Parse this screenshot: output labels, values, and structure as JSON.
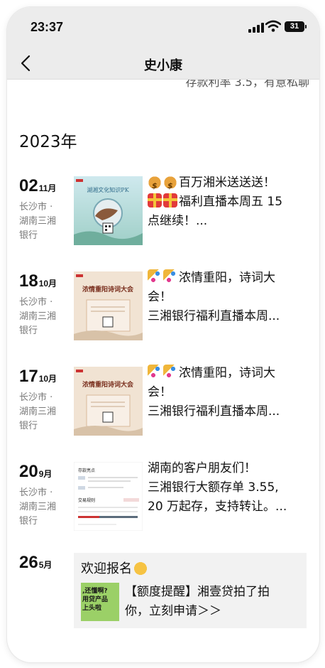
{
  "status_bar": {
    "time": "23:37",
    "battery": "31"
  },
  "nav": {
    "title": "史小康"
  },
  "peek_text": "存款利率 3.5，有意私聊",
  "year_header": "2023年",
  "posts": [
    {
      "day": "02",
      "month": "11月",
      "location_lines": [
        "长沙市 ·",
        "湖南三湘",
        "银行"
      ],
      "thumb": {
        "banner": "湖湘文化知识PK"
      },
      "lines": [
        "百万湘米送送送！",
        "福利直播本周五 15",
        "点继续！..."
      ],
      "emoji": [
        "money-bag-icon",
        "money-bag-icon",
        "gift-icon",
        "gift-icon"
      ]
    },
    {
      "day": "18",
      "month": "10月",
      "location_lines": [
        "长沙市 ·",
        "湖南三湘",
        "银行"
      ],
      "thumb": {
        "banner": "浓情重阳诗词大会"
      },
      "lines": [
        "浓情重阳，诗词大",
        "会！",
        "三湘银行福利直播本周..."
      ],
      "emoji": [
        "party-popper-icon",
        "party-popper-icon"
      ]
    },
    {
      "day": "17",
      "month": "10月",
      "location_lines": [
        "长沙市 ·",
        "湖南三湘",
        "银行"
      ],
      "thumb": {
        "banner": "浓情重阳诗词大会"
      },
      "lines": [
        "浓情重阳，诗词大",
        "会！",
        "三湘银行福利直播本周..."
      ],
      "emoji": [
        "party-popper-icon",
        "party-popper-icon"
      ]
    },
    {
      "day": "20",
      "month": "9月",
      "location_lines": [
        "长沙市 ·",
        "湖南三湘",
        "银行"
      ],
      "thumb": {
        "heading": "存款亮点",
        "rules": "交易规则"
      },
      "lines": [
        "湖南的客户朋友们！",
        "三湘银行大额存单 3.55,",
        "20 万起存，支持转让。..."
      ],
      "emoji": []
    }
  ],
  "last_post": {
    "day": "26",
    "month": "5月",
    "card_title": "欢迎报名",
    "card_image_lines": [
      ",还懂啊?",
      "用贷产品",
      "上头啦"
    ],
    "card_lines": [
      "【额度提醒】湘壹贷拍了拍",
      "你，立刻申请＞＞"
    ],
    "emoji": [
      "clapping-hands-icon"
    ]
  }
}
